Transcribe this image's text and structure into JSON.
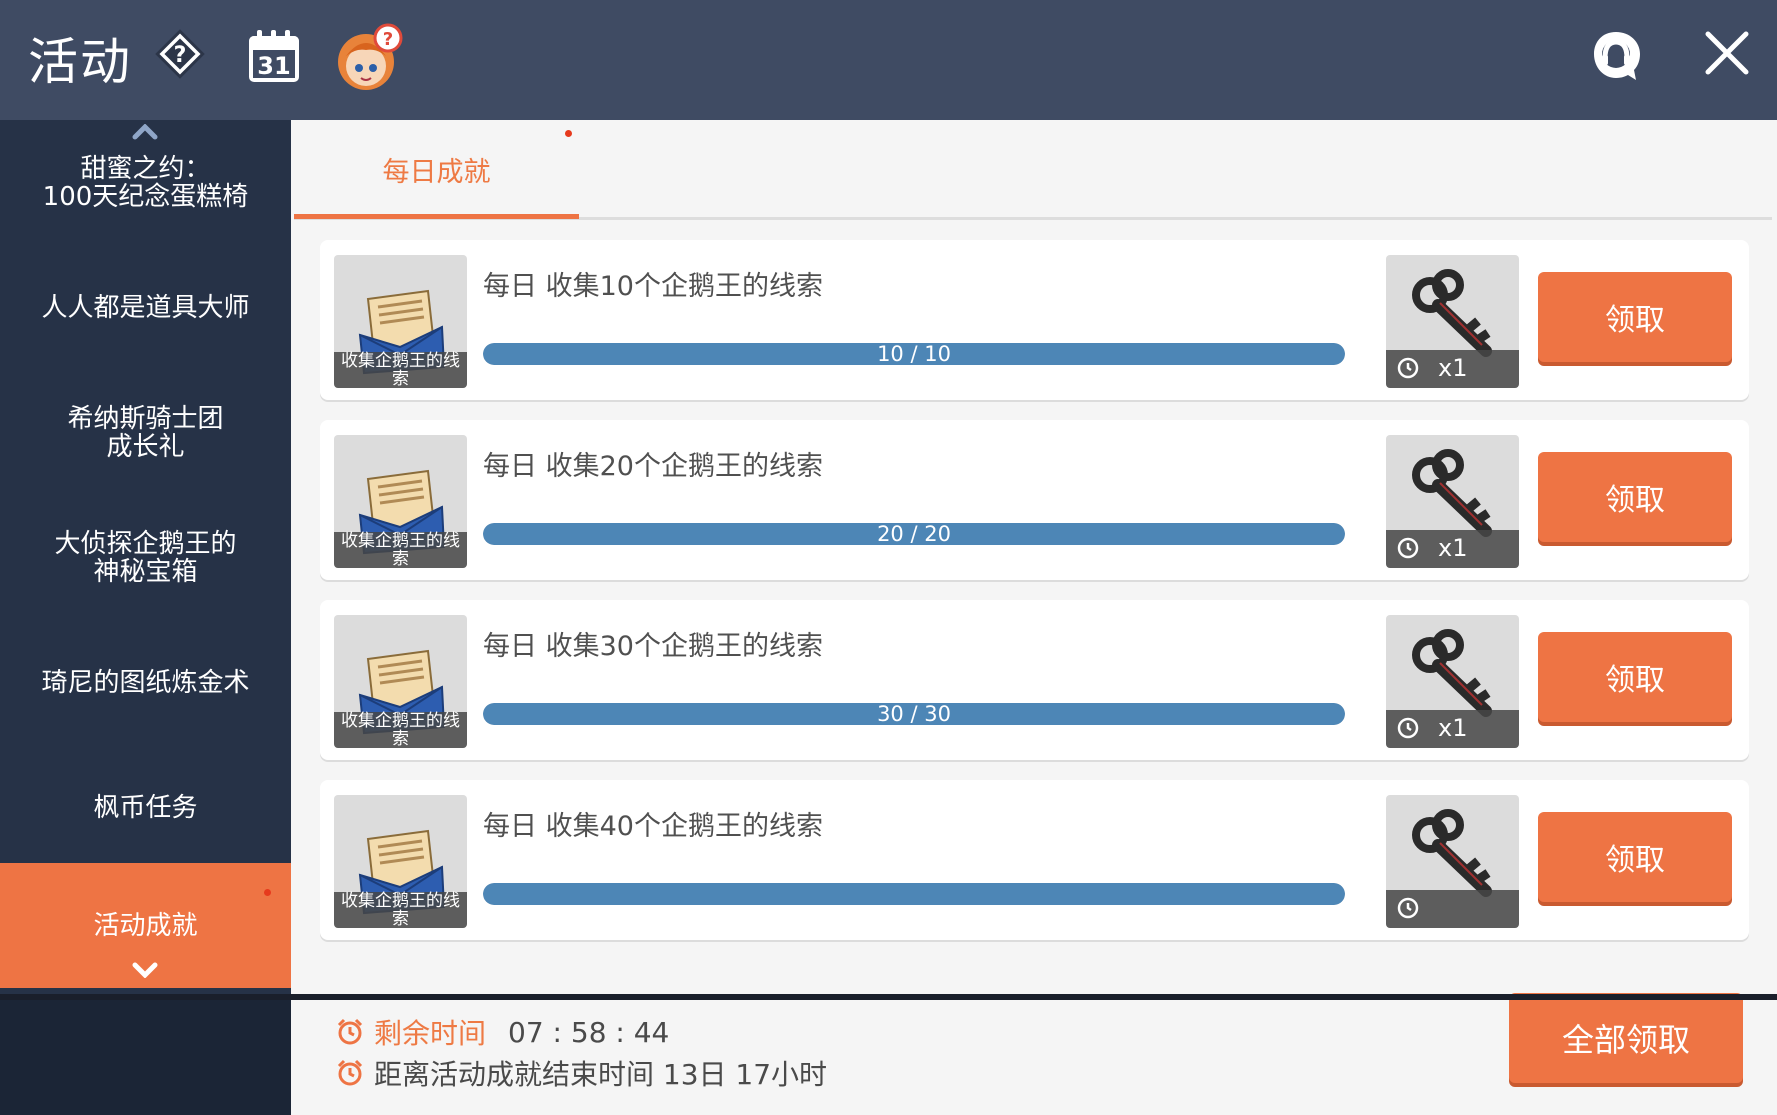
{
  "header": {
    "title": "活动",
    "icons": [
      "help-icon",
      "calendar-icon",
      "character-avatar-icon",
      "customer-support-icon",
      "close-icon"
    ],
    "calendar_day": "31"
  },
  "sidebar": {
    "items": [
      {
        "label": "甜蜜之约：\n100天纪念蛋糕椅"
      },
      {
        "label": "人人都是道具大师"
      },
      {
        "label": "希纳斯骑士团\n成长礼"
      },
      {
        "label": "大侦探企鹅王的\n神秘宝箱"
      },
      {
        "label": "琦尼的图纸炼金术"
      },
      {
        "label": "枫币任务"
      },
      {
        "label": "活动成就"
      }
    ],
    "active_index": 6
  },
  "tabs": [
    {
      "label": "每日成就"
    }
  ],
  "tasks": [
    {
      "title": "每日 收集10个企鹅王的线索",
      "item_caption": "收集企鹅王的线索",
      "progress": "10 / 10",
      "fraction": 1.0,
      "reward_qty": "x1",
      "button": "领取"
    },
    {
      "title": "每日 收集20个企鹅王的线索",
      "item_caption": "收集企鹅王的线索",
      "progress": "20 / 20",
      "fraction": 1.0,
      "reward_qty": "x1",
      "button": "领取"
    },
    {
      "title": "每日 收集30个企鹅王的线索",
      "item_caption": "收集企鹅王的线索",
      "progress": "30 / 30",
      "fraction": 1.0,
      "reward_qty": "x1",
      "button": "领取"
    },
    {
      "title": "每日 收集40个企鹅王的线索",
      "item_caption": "收集企鹅王的线索",
      "progress": "",
      "fraction": 1.0,
      "reward_qty": "",
      "button": "领取"
    }
  ],
  "footer": {
    "remaining_label": "剩余时间",
    "remaining_time": "07 : 58 : 44",
    "end_text": "距离活动成就结束时间 13日 17小时",
    "claim_all": "全部领取"
  },
  "colors": {
    "accent": "#ee7444",
    "header_bg": "#3f4b63",
    "sidebar_bg": "#263247",
    "progress": "#4d86b6"
  }
}
